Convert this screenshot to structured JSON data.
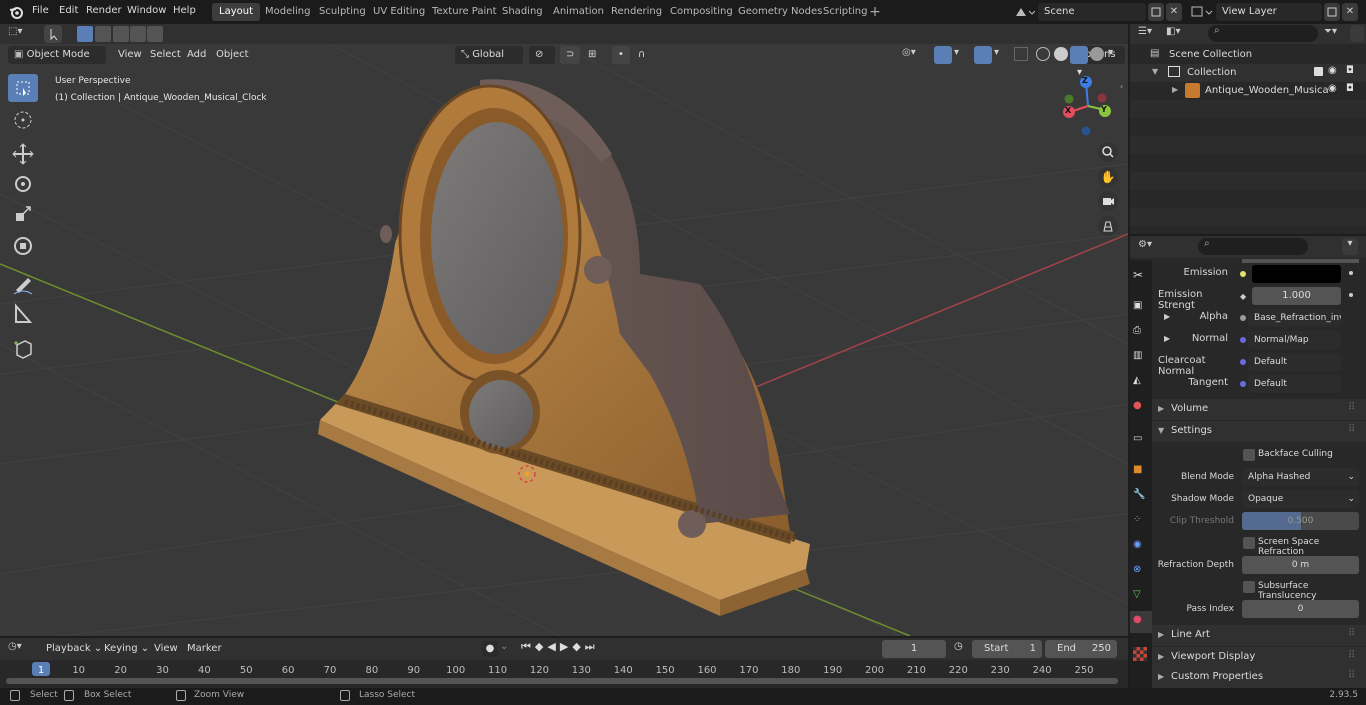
{
  "topbar": {
    "menus": [
      "File",
      "Edit",
      "Render",
      "Window",
      "Help"
    ],
    "workspaces": [
      "Layout",
      "Modeling",
      "Sculpting",
      "UV Editing",
      "Texture Paint",
      "Shading",
      "Animation",
      "Rendering",
      "Compositing",
      "Geometry Nodes",
      "Scripting"
    ],
    "active_workspace": "Layout",
    "scene": "Scene",
    "view_layer": "View Layer"
  },
  "viewport_header": {
    "mode": "Object Mode",
    "menus": [
      "View",
      "Select",
      "Add",
      "Object"
    ],
    "orientation": "Global",
    "options": "Options"
  },
  "viewport": {
    "perspective": "User Perspective",
    "collection_info": "(1) Collection | Antique_Wooden_Musical_Clock",
    "gizmo_axes": {
      "x": "X",
      "y": "Y",
      "z": "Z"
    }
  },
  "outliner": {
    "scene_collection": "Scene Collection",
    "collection": "Collection",
    "object": "Antique_Wooden_Musica"
  },
  "properties": {
    "rows": [
      {
        "label": "Emission",
        "value": ""
      },
      {
        "label": "Emission Strengt",
        "value": "1.000"
      },
      {
        "label": "Alpha",
        "value": "Base_Refraction_inv..."
      },
      {
        "label": "Normal",
        "value": "Normal/Map"
      },
      {
        "label": "Clearcoat Normal",
        "value": "Default"
      },
      {
        "label": "Tangent",
        "value": "Default"
      }
    ],
    "volume": "Volume",
    "settings": "Settings",
    "backface_culling": "Backface Culling",
    "blend_mode_label": "Blend Mode",
    "blend_mode": "Alpha Hashed",
    "shadow_mode_label": "Shadow Mode",
    "shadow_mode": "Opaque",
    "clip_threshold_label": "Clip Threshold",
    "clip_threshold": "0.500",
    "screen_space_refraction": "Screen Space Refraction",
    "refraction_depth_label": "Refraction Depth",
    "refraction_depth": "0 m",
    "subsurface_translucency": "Subsurface Translucency",
    "pass_index_label": "Pass Index",
    "pass_index": "0",
    "line_art": "Line Art",
    "viewport_display": "Viewport Display",
    "custom_properties": "Custom Properties"
  },
  "timeline": {
    "menus": [
      "Playback",
      "Keying",
      "View",
      "Marker"
    ],
    "current_frame": "1",
    "start_label": "Start",
    "start": "1",
    "end_label": "End",
    "end": "250",
    "ticks": [
      "1",
      "10",
      "20",
      "30",
      "40",
      "50",
      "60",
      "70",
      "80",
      "90",
      "100",
      "110",
      "120",
      "130",
      "140",
      "150",
      "160",
      "170",
      "180",
      "190",
      "200",
      "210",
      "220",
      "230",
      "240",
      "250"
    ]
  },
  "statusbar": {
    "select": "Select",
    "box_select": "Box Select",
    "zoom_view": "Zoom View",
    "lasso_select": "Lasso Select",
    "version": "2.93.5"
  },
  "colors": {
    "accent": "#5a7fb7",
    "viewport_bg": "#393939",
    "x_axis": "#e44d5b",
    "y_axis": "#8cc43c",
    "z_axis": "#3c7ee6"
  }
}
